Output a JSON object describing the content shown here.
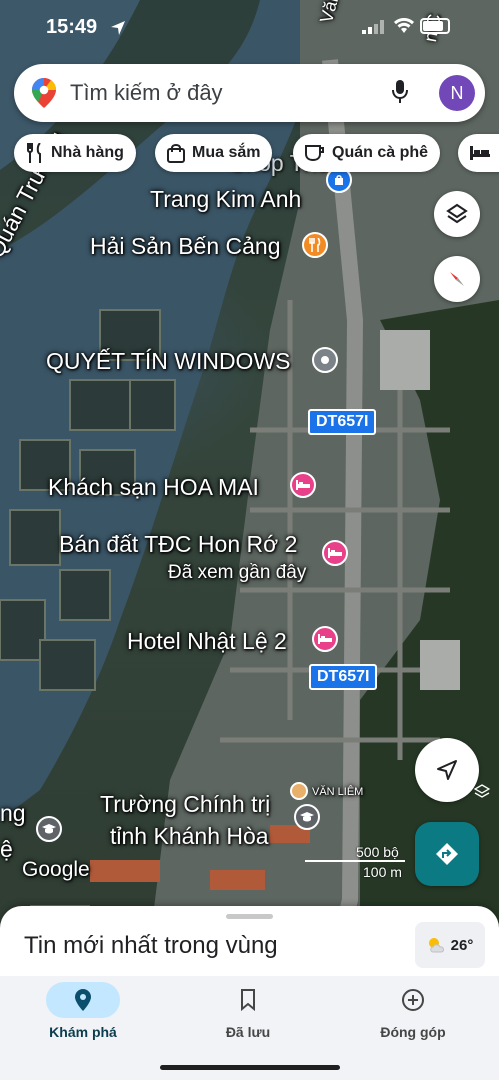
{
  "status_bar": {
    "time": "15:49"
  },
  "search": {
    "placeholder": "Tìm kiếm ở đây",
    "avatar_initial": "N"
  },
  "chips": [
    {
      "label": "Nhà hàng",
      "icon": "fork-knife-icon"
    },
    {
      "label": "Mua sắm",
      "icon": "shopping-bag-icon"
    },
    {
      "label": "Quán cà phê",
      "icon": "coffee-cup-icon"
    },
    {
      "label": "",
      "icon": "bed-icon"
    }
  ],
  "map": {
    "labels": {
      "shop_partial": "Shop Thờ",
      "trang_kim_anh": "Trang Kim Anh",
      "hai_san": "Hải Sản Bến Cảng",
      "quyet_tin": "QUYẾT TÍN WINDOWS",
      "hoa_mai": "Khách sạn HOA MAI",
      "ban_dat": "Bán đất TĐC Hon Rớ 2",
      "ban_dat_sub": "Đã xem gần đây",
      "nhat_le": "Hotel Nhật Lệ 2",
      "truong_1": "Trường Chính trị",
      "truong_2": "tỉnh Khánh Hòa",
      "quan_truong": "Quán Trường",
      "van_liem": "VĂN LIÊM",
      "left_partial_1": "ng",
      "left_partial_2": "ệ",
      "top_right_street": "Văn K",
      "top_right_partial": "n C",
      "google": "Google"
    },
    "route_shields": [
      "DT657I",
      "DT657I"
    ],
    "scale": {
      "imperial": "500 bộ",
      "metric": "100 m"
    }
  },
  "bottom_sheet": {
    "title": "Tin mới nhất trong vùng",
    "temperature": "26°"
  },
  "nav": [
    {
      "label": "Khám phá",
      "icon": "location-pin-icon",
      "active": true
    },
    {
      "label": "Đã lưu",
      "icon": "bookmark-icon",
      "active": false
    },
    {
      "label": "Đóng góp",
      "icon": "add-circle-icon",
      "active": false
    }
  ],
  "colors": {
    "accent": "#1a73e8",
    "directions_button": "#0b7a82",
    "restaurant_pin": "#f28b24",
    "hotel_pin": "#e8418a",
    "school_pin": "#5f6368",
    "nav_active_pill": "#c2e7ff"
  }
}
